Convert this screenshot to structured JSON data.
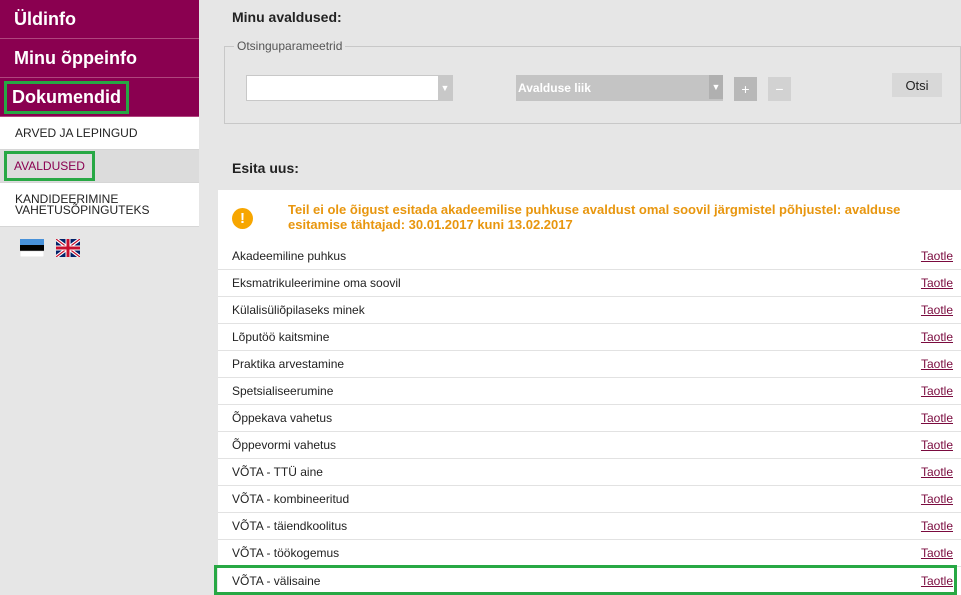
{
  "sidebar": {
    "main_items": [
      {
        "label": "Üldinfo"
      },
      {
        "label": "Minu õppeinfo"
      },
      {
        "label": "Dokumendid"
      }
    ],
    "sub_items": [
      {
        "label": "ARVED JA LEPINGUD"
      },
      {
        "label": "AVALDUSED"
      },
      {
        "label": "KANDIDEERIMINE VAHETUSÕPINGUTEKS"
      }
    ],
    "flags": [
      "estonian-flag-icon",
      "uk-flag-icon"
    ]
  },
  "main": {
    "title": "Minu avaldused:",
    "search": {
      "legend": "Otsinguparameetrid",
      "select1_value": "",
      "select2_value": "Avalduse liik",
      "plus_label": "+",
      "minus_label": "−",
      "search_button": "Otsi"
    },
    "submit_title": "Esita uus:",
    "warning": "Teil ei ole õigust esitada akadeemilise puhkuse avaldust omal soovil järgmistel põhjustel: avalduse esitamise tähtajad: 30.01.2017 kuni 13.02.2017",
    "rows": [
      {
        "name": "Akadeemiline puhkus",
        "action": "Taotle"
      },
      {
        "name": "Eksmatrikuleerimine oma soovil",
        "action": "Taotle"
      },
      {
        "name": "Külalisüliõpilaseks minek",
        "action": "Taotle"
      },
      {
        "name": "Lõputöö kaitsmine",
        "action": "Taotle"
      },
      {
        "name": "Praktika arvestamine",
        "action": "Taotle"
      },
      {
        "name": "Spetsialiseerumine",
        "action": "Taotle"
      },
      {
        "name": "Õppekava vahetus",
        "action": "Taotle"
      },
      {
        "name": "Õppevormi vahetus",
        "action": "Taotle"
      },
      {
        "name": "VÕTA - TTÜ aine",
        "action": "Taotle"
      },
      {
        "name": "VÕTA - kombineeritud",
        "action": "Taotle"
      },
      {
        "name": "VÕTA - täiendkoolitus",
        "action": "Taotle"
      },
      {
        "name": "VÕTA - töökogemus",
        "action": "Taotle"
      },
      {
        "name": "VÕTA - välisaine",
        "action": "Taotle"
      }
    ]
  },
  "colors": {
    "brand": "#8a0050",
    "highlight": "#27a844",
    "warning": "#e8960e",
    "link": "#7a0a3e"
  }
}
